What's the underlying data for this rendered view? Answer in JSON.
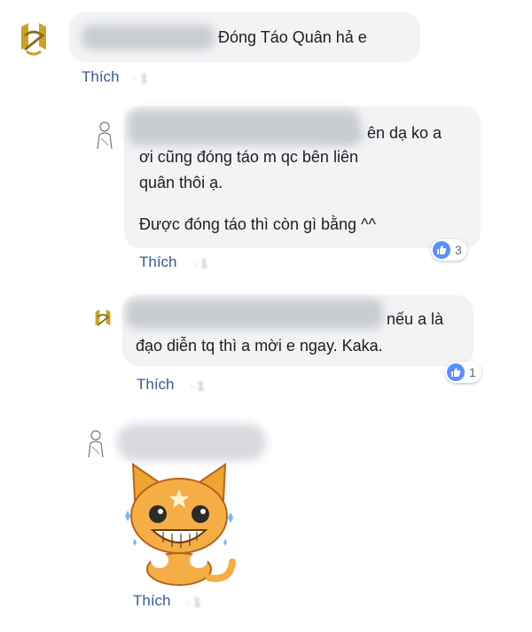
{
  "comments": [
    {
      "text": "Đóng Táo Quân hả e",
      "action": "Thích",
      "meta": "· 1"
    },
    {
      "line1": "ên dạ ko a",
      "line2": "ơi cũng đóng táo m qc bên liên",
      "line3": "quân thôi ạ.",
      "line4": "Được đóng táo thì còn gì bằng ^^",
      "reactions": "3",
      "action": "Thích",
      "meta": "· 1"
    },
    {
      "line1": "nếu a là",
      "line2": "đạo diễn tq thì a mời e ngay. Kaka.",
      "reactions": "1",
      "action": "Thích",
      "meta": "· 1"
    },
    {
      "sticker": "cat-sticker",
      "action": "Thích",
      "meta": "· 1"
    }
  ],
  "colors": {
    "link": "#385898",
    "bubble": "#f2f3f5",
    "like": "#5890ff"
  }
}
